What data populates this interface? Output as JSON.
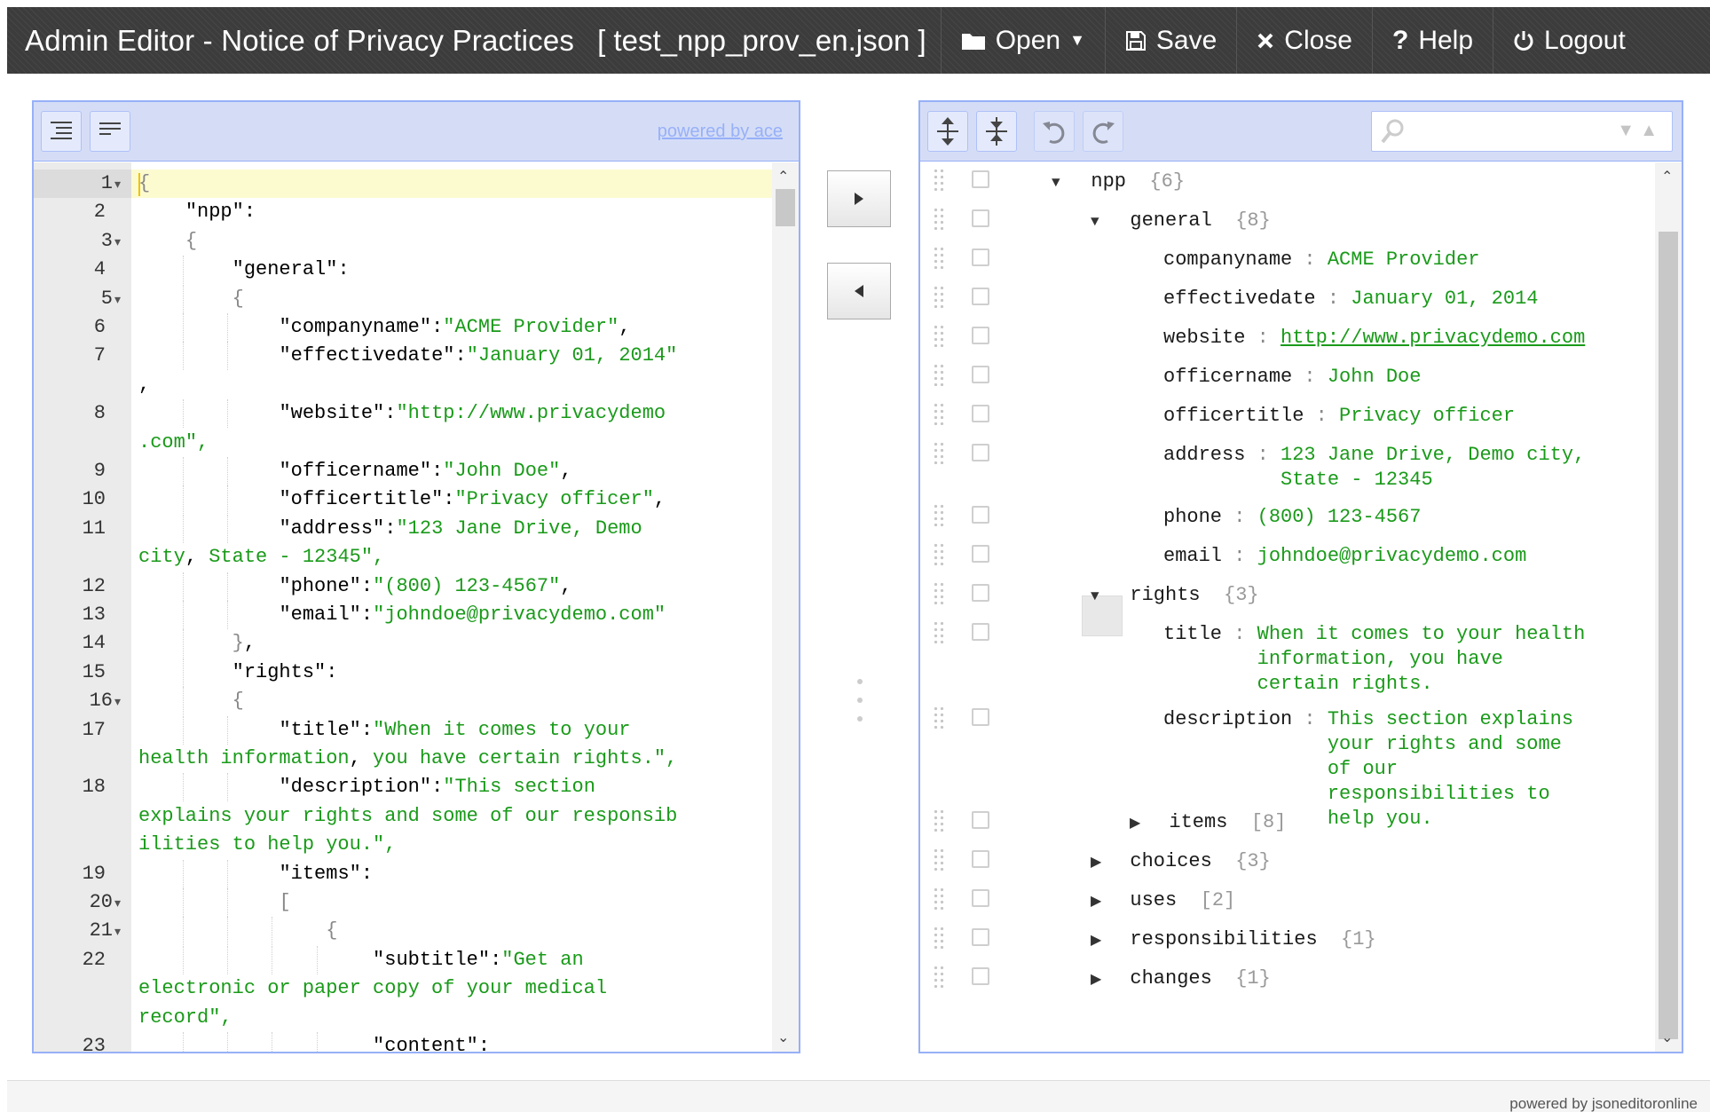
{
  "header": {
    "title": "Admin Editor - Notice of Privacy Practices",
    "filename": "[ test_npp_prov_en.json ]",
    "buttons": {
      "open": "Open",
      "save": "Save",
      "close": "Close",
      "help": "Help",
      "logout": "Logout"
    }
  },
  "left_panel": {
    "powered_by": "powered by ace",
    "tools": [
      "format-icon",
      "compact-icon"
    ]
  },
  "code_lines": [
    {
      "n": "1",
      "fold": true,
      "text": "{"
    },
    {
      "n": "2",
      "fold": false,
      "text": "    \"npp\":"
    },
    {
      "n": "3",
      "fold": true,
      "text": "    {"
    },
    {
      "n": "4",
      "fold": false,
      "text": "        \"general\":"
    },
    {
      "n": "5",
      "fold": true,
      "text": "        {"
    },
    {
      "n": "6",
      "fold": false,
      "text": "            \"companyname\":\"ACME Provider\","
    },
    {
      "n": "7",
      "fold": false,
      "text": "            \"effectivedate\":\"January 01, 2014\""
    },
    {
      "n": "",
      "fold": false,
      "text": ","
    },
    {
      "n": "8",
      "fold": false,
      "text": "            \"website\":\"http://www.privacydemo"
    },
    {
      "n": "",
      "fold": false,
      "text": ".com\","
    },
    {
      "n": "9",
      "fold": false,
      "text": "            \"officername\":\"John Doe\","
    },
    {
      "n": "10",
      "fold": false,
      "text": "            \"officertitle\":\"Privacy officer\","
    },
    {
      "n": "11",
      "fold": false,
      "text": "            \"address\":\"123 Jane Drive, Demo"
    },
    {
      "n": "",
      "fold": false,
      "text": "city, State - 12345\","
    },
    {
      "n": "12",
      "fold": false,
      "text": "            \"phone\":\"(800) 123-4567\","
    },
    {
      "n": "13",
      "fold": false,
      "text": "            \"email\":\"johndoe@privacydemo.com\""
    },
    {
      "n": "14",
      "fold": false,
      "text": "        },"
    },
    {
      "n": "15",
      "fold": false,
      "text": "        \"rights\":"
    },
    {
      "n": "16",
      "fold": true,
      "text": "        {"
    },
    {
      "n": "17",
      "fold": false,
      "text": "            \"title\":\"When it comes to your"
    },
    {
      "n": "",
      "fold": false,
      "text": "health information, you have certain rights.\","
    },
    {
      "n": "18",
      "fold": false,
      "text": "            \"description\":\"This section"
    },
    {
      "n": "",
      "fold": false,
      "text": "explains your rights and some of our responsib"
    },
    {
      "n": "",
      "fold": false,
      "text": "ilities to help you.\","
    },
    {
      "n": "19",
      "fold": false,
      "text": "            \"items\":"
    },
    {
      "n": "20",
      "fold": true,
      "text": "            ["
    },
    {
      "n": "21",
      "fold": true,
      "text": "                {"
    },
    {
      "n": "22",
      "fold": false,
      "text": "                    \"subtitle\":\"Get an"
    },
    {
      "n": "",
      "fold": false,
      "text": "electronic or paper copy of your medical"
    },
    {
      "n": "",
      "fold": false,
      "text": "record\","
    },
    {
      "n": "23",
      "fold": false,
      "text": "                    \"content\":"
    }
  ],
  "tree": {
    "search_placeholder": "",
    "nodes": [
      {
        "key": "npp",
        "count": "{6}",
        "expanded": true,
        "level": 0
      },
      {
        "key": "general",
        "count": "{8}",
        "expanded": true,
        "level": 1
      },
      {
        "key": "companyname",
        "value": "ACME Provider",
        "level": 2
      },
      {
        "key": "effectivedate",
        "value": "January 01, 2014",
        "level": 2
      },
      {
        "key": "website",
        "value": "http://www.privacydemo.com",
        "level": 2,
        "url": true
      },
      {
        "key": "officername",
        "value": "John Doe",
        "level": 2
      },
      {
        "key": "officertitle",
        "value": "Privacy officer",
        "level": 2
      },
      {
        "key": "address",
        "value": "123 Jane Drive, Demo city,\nState - 12345",
        "level": 2
      },
      {
        "key": "phone",
        "value": "(800) 123-4567",
        "level": 2
      },
      {
        "key": "email",
        "value": "johndoe@privacydemo.com",
        "level": 2
      },
      {
        "key": "rights",
        "count": "{3}",
        "expanded": true,
        "level": 1
      },
      {
        "key": "title",
        "value": "When it comes to your health\ninformation, you have\ncertain rights.",
        "level": 2
      },
      {
        "key": "description",
        "value": "This section explains\nyour rights and some\nof our\nresponsibilities to\nhelp you.",
        "level": 2
      },
      {
        "key": "items",
        "count": "[8]",
        "expanded": false,
        "level": 2
      },
      {
        "key": "choices",
        "count": "{3}",
        "expanded": false,
        "level": 1
      },
      {
        "key": "uses",
        "count": "[2]",
        "expanded": false,
        "level": 1
      },
      {
        "key": "responsibilities",
        "count": "{1}",
        "expanded": false,
        "level": 1
      },
      {
        "key": "changes",
        "count": "{1}",
        "expanded": false,
        "level": 1
      }
    ]
  },
  "footer": {
    "powered_by": "powered by jsoneditoronline"
  }
}
